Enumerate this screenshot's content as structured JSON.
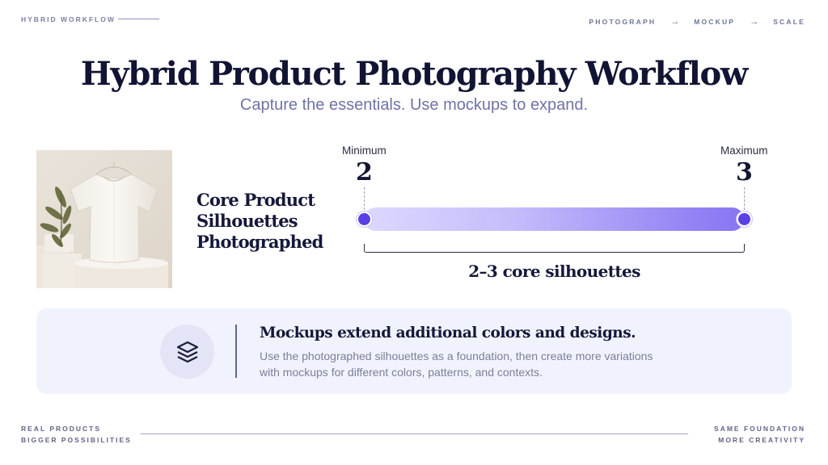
{
  "header": {
    "brand": "HYBRID WORKFLOW",
    "steps": [
      "PHOTOGRAPH",
      "MOCKUP",
      "SCALE"
    ],
    "arrow": "→"
  },
  "hero": {
    "title": "Hybrid Product Photography Workflow",
    "subtitle": "Capture the essentials. Use mockups to expand."
  },
  "product": {
    "image_icon": "tshirt-product-photo",
    "label_lines": [
      "Core Product",
      "Silhouettes",
      "Photographed"
    ]
  },
  "range": {
    "min_caption": "Minimum",
    "min_value": "2",
    "max_caption": "Maximum",
    "max_value": "3",
    "summary": "2–3 core silhouettes",
    "colors": {
      "start": "#dcd9ff",
      "end": "#8775f2",
      "dot": "#5b40e6"
    }
  },
  "card": {
    "icon": "layers-icon",
    "title": "Mockups extend additional colors and designs.",
    "body_lines": [
      "Use the photographed silhouettes as a foundation, then create more variations",
      "with mockups for different colors, patterns, and contexts."
    ]
  },
  "footer": {
    "left_lines": [
      "REAL PRODUCTS",
      "BIGGER POSSIBILITIES"
    ],
    "right_lines": [
      "SAME FOUNDATION",
      "MORE CREATIVITY"
    ]
  }
}
